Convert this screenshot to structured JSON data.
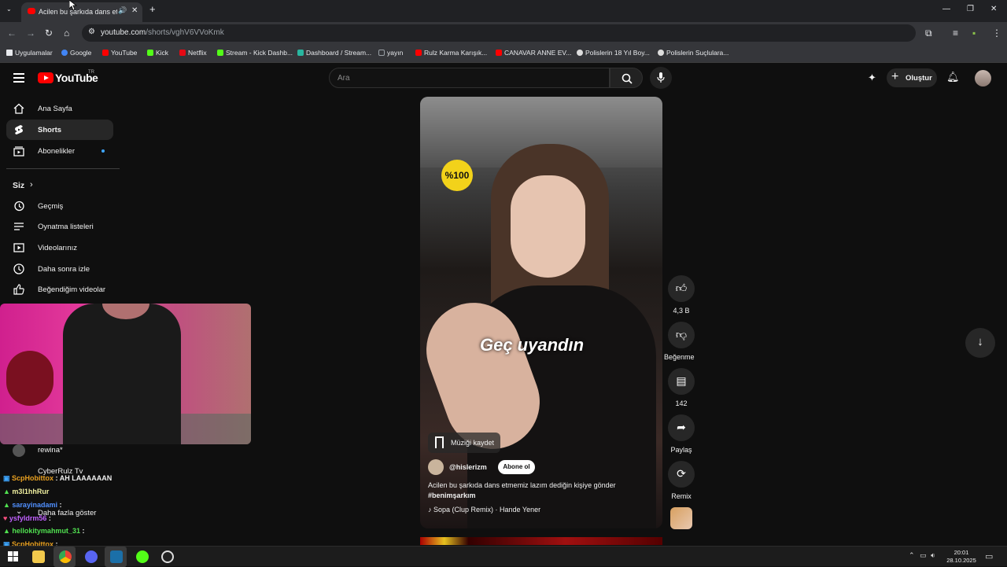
{
  "browser": {
    "tab_title": "Acilen bu şarkıda dans etmemiz lazım",
    "sound_icon": "speaker-icon",
    "url_host": "youtube.com",
    "url_path": "/shorts/vghV6VVoKmk",
    "bookmarks": [
      {
        "label": "Uygulamalar",
        "color": "#ffffff"
      },
      {
        "label": "Google",
        "color": "#4285f4"
      },
      {
        "label": "YouTube",
        "color": "#ff0000"
      },
      {
        "label": "Kick",
        "color": "#53fc18"
      },
      {
        "label": "Netflix",
        "color": "#e50914"
      },
      {
        "label": "Stream - Kick Dashb...",
        "color": "#53fc18"
      },
      {
        "label": "Dashboard / Stream...",
        "color": "#29b6a0"
      },
      {
        "label": "yayın",
        "color": "#9aa0a6"
      },
      {
        "label": "Rulz Karma Karışık...",
        "color": "#ff0000"
      },
      {
        "label": "CANAVAR ANNE EV...",
        "color": "#ff0000"
      },
      {
        "label": "Polislerin 18 Yıl Boy...",
        "color": "#dddddd"
      },
      {
        "label": "Polislerin Suçlulara...",
        "color": "#dddddd"
      }
    ]
  },
  "youtube": {
    "logo_text": "YouTube",
    "country_code": "TR",
    "search_placeholder": "Ara",
    "create_label": "Oluştur"
  },
  "sidebar": {
    "items": [
      {
        "label": "Ana Sayfa",
        "icon": "home-icon"
      },
      {
        "label": "Shorts",
        "icon": "shorts-icon"
      },
      {
        "label": "Abonelikler",
        "icon": "subscriptions-icon"
      }
    ],
    "you_section": "Siz",
    "you_items": [
      {
        "label": "Geçmiş",
        "icon": "history-icon"
      },
      {
        "label": "Oynatma listeleri",
        "icon": "playlists-icon"
      },
      {
        "label": "Videolarınız",
        "icon": "your-videos-icon"
      },
      {
        "label": "Daha sonra izle",
        "icon": "watch-later-icon"
      },
      {
        "label": "Beğendiğim videolar",
        "icon": "liked-icon"
      }
    ],
    "sub_partial": [
      "rewina*",
      "CyberRulz Tv",
      "Daha fazla göster"
    ]
  },
  "chat": [
    {
      "user": "ScpHobittox",
      "msg": ": AH LAAAAAAN",
      "color": "#e8a020"
    },
    {
      "user": "m3l1hhRur",
      "msg": "",
      "color": "#f0f0a0"
    },
    {
      "user": "sarayinadami",
      "msg": ":",
      "color": "#5090ff"
    },
    {
      "user": "ysfyldrm56",
      "msg": ":",
      "color": "#c060ff"
    },
    {
      "user": "hellokitymahmut_31",
      "msg": ":",
      "color": "#50e050"
    },
    {
      "user": "ScpHobittox",
      "msg": ":",
      "color": "#e8a020"
    }
  ],
  "short": {
    "overlay_logo": "%100",
    "caption": "Geç uyandın",
    "save_music": "Müziği kaydet",
    "channel": "@hislerizm",
    "subscribe": "Abone ol",
    "description": "Acilen bu şarkıda dans etmemiz lazım dediğin kişiye gönder",
    "hashtag": "#benimşarkım",
    "song": "Sopa (Clup Remix) · Hande Yener"
  },
  "actions": {
    "likes": "4,3 B",
    "dislike": "Beğenme",
    "comments": "142",
    "share": "Paylaş",
    "remix": "Remix"
  },
  "taskbar": {
    "time": "20:01",
    "date": "28.10.2025"
  }
}
